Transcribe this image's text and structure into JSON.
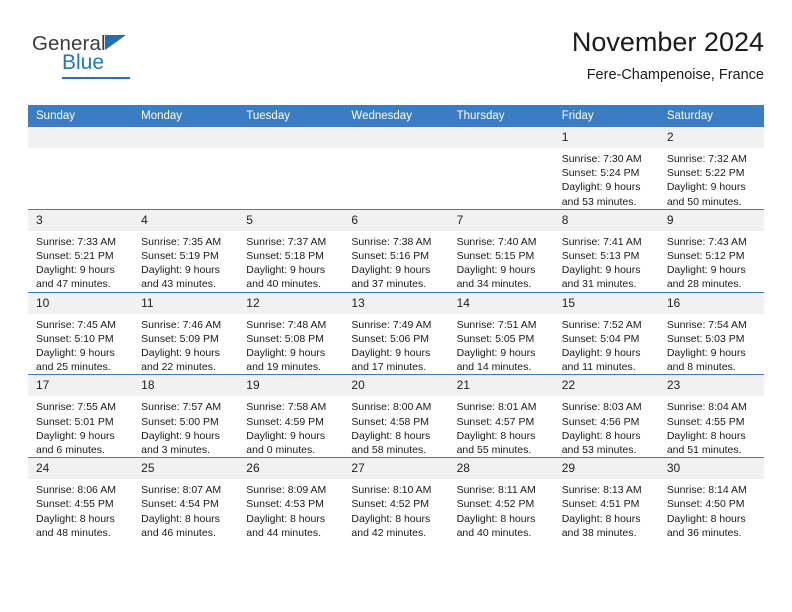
{
  "brand": {
    "name_part1": "General",
    "name_part2": "Blue",
    "accent_color": "#2077b9"
  },
  "header": {
    "title": "November 2024",
    "subtitle": "Fere-Champenoise, France"
  },
  "theme": {
    "header_row_color": "#3b7dc4",
    "daynum_bg": "#f1f1f1",
    "grid_line": "#3b7dc4"
  },
  "weekday_headers": [
    "Sunday",
    "Monday",
    "Tuesday",
    "Wednesday",
    "Thursday",
    "Friday",
    "Saturday"
  ],
  "labels": {
    "sunrise_prefix": "Sunrise:",
    "sunset_prefix": "Sunset:",
    "daylight_prefix": "Daylight:"
  },
  "weeks": [
    [
      {
        "day": "",
        "empty": true
      },
      {
        "day": "",
        "empty": true
      },
      {
        "day": "",
        "empty": true
      },
      {
        "day": "",
        "empty": true
      },
      {
        "day": "",
        "empty": true
      },
      {
        "day": "1",
        "sunrise": "Sunrise: 7:30 AM",
        "sunset": "Sunset: 5:24 PM",
        "daylight1": "Daylight: 9 hours",
        "daylight2": "and 53 minutes."
      },
      {
        "day": "2",
        "sunrise": "Sunrise: 7:32 AM",
        "sunset": "Sunset: 5:22 PM",
        "daylight1": "Daylight: 9 hours",
        "daylight2": "and 50 minutes."
      }
    ],
    [
      {
        "day": "3",
        "sunrise": "Sunrise: 7:33 AM",
        "sunset": "Sunset: 5:21 PM",
        "daylight1": "Daylight: 9 hours",
        "daylight2": "and 47 minutes."
      },
      {
        "day": "4",
        "sunrise": "Sunrise: 7:35 AM",
        "sunset": "Sunset: 5:19 PM",
        "daylight1": "Daylight: 9 hours",
        "daylight2": "and 43 minutes."
      },
      {
        "day": "5",
        "sunrise": "Sunrise: 7:37 AM",
        "sunset": "Sunset: 5:18 PM",
        "daylight1": "Daylight: 9 hours",
        "daylight2": "and 40 minutes."
      },
      {
        "day": "6",
        "sunrise": "Sunrise: 7:38 AM",
        "sunset": "Sunset: 5:16 PM",
        "daylight1": "Daylight: 9 hours",
        "daylight2": "and 37 minutes."
      },
      {
        "day": "7",
        "sunrise": "Sunrise: 7:40 AM",
        "sunset": "Sunset: 5:15 PM",
        "daylight1": "Daylight: 9 hours",
        "daylight2": "and 34 minutes."
      },
      {
        "day": "8",
        "sunrise": "Sunrise: 7:41 AM",
        "sunset": "Sunset: 5:13 PM",
        "daylight1": "Daylight: 9 hours",
        "daylight2": "and 31 minutes."
      },
      {
        "day": "9",
        "sunrise": "Sunrise: 7:43 AM",
        "sunset": "Sunset: 5:12 PM",
        "daylight1": "Daylight: 9 hours",
        "daylight2": "and 28 minutes."
      }
    ],
    [
      {
        "day": "10",
        "sunrise": "Sunrise: 7:45 AM",
        "sunset": "Sunset: 5:10 PM",
        "daylight1": "Daylight: 9 hours",
        "daylight2": "and 25 minutes."
      },
      {
        "day": "11",
        "sunrise": "Sunrise: 7:46 AM",
        "sunset": "Sunset: 5:09 PM",
        "daylight1": "Daylight: 9 hours",
        "daylight2": "and 22 minutes."
      },
      {
        "day": "12",
        "sunrise": "Sunrise: 7:48 AM",
        "sunset": "Sunset: 5:08 PM",
        "daylight1": "Daylight: 9 hours",
        "daylight2": "and 19 minutes."
      },
      {
        "day": "13",
        "sunrise": "Sunrise: 7:49 AM",
        "sunset": "Sunset: 5:06 PM",
        "daylight1": "Daylight: 9 hours",
        "daylight2": "and 17 minutes."
      },
      {
        "day": "14",
        "sunrise": "Sunrise: 7:51 AM",
        "sunset": "Sunset: 5:05 PM",
        "daylight1": "Daylight: 9 hours",
        "daylight2": "and 14 minutes."
      },
      {
        "day": "15",
        "sunrise": "Sunrise: 7:52 AM",
        "sunset": "Sunset: 5:04 PM",
        "daylight1": "Daylight: 9 hours",
        "daylight2": "and 11 minutes."
      },
      {
        "day": "16",
        "sunrise": "Sunrise: 7:54 AM",
        "sunset": "Sunset: 5:03 PM",
        "daylight1": "Daylight: 9 hours",
        "daylight2": "and 8 minutes."
      }
    ],
    [
      {
        "day": "17",
        "sunrise": "Sunrise: 7:55 AM",
        "sunset": "Sunset: 5:01 PM",
        "daylight1": "Daylight: 9 hours",
        "daylight2": "and 6 minutes."
      },
      {
        "day": "18",
        "sunrise": "Sunrise: 7:57 AM",
        "sunset": "Sunset: 5:00 PM",
        "daylight1": "Daylight: 9 hours",
        "daylight2": "and 3 minutes."
      },
      {
        "day": "19",
        "sunrise": "Sunrise: 7:58 AM",
        "sunset": "Sunset: 4:59 PM",
        "daylight1": "Daylight: 9 hours",
        "daylight2": "and 0 minutes."
      },
      {
        "day": "20",
        "sunrise": "Sunrise: 8:00 AM",
        "sunset": "Sunset: 4:58 PM",
        "daylight1": "Daylight: 8 hours",
        "daylight2": "and 58 minutes."
      },
      {
        "day": "21",
        "sunrise": "Sunrise: 8:01 AM",
        "sunset": "Sunset: 4:57 PM",
        "daylight1": "Daylight: 8 hours",
        "daylight2": "and 55 minutes."
      },
      {
        "day": "22",
        "sunrise": "Sunrise: 8:03 AM",
        "sunset": "Sunset: 4:56 PM",
        "daylight1": "Daylight: 8 hours",
        "daylight2": "and 53 minutes."
      },
      {
        "day": "23",
        "sunrise": "Sunrise: 8:04 AM",
        "sunset": "Sunset: 4:55 PM",
        "daylight1": "Daylight: 8 hours",
        "daylight2": "and 51 minutes."
      }
    ],
    [
      {
        "day": "24",
        "sunrise": "Sunrise: 8:06 AM",
        "sunset": "Sunset: 4:55 PM",
        "daylight1": "Daylight: 8 hours",
        "daylight2": "and 48 minutes."
      },
      {
        "day": "25",
        "sunrise": "Sunrise: 8:07 AM",
        "sunset": "Sunset: 4:54 PM",
        "daylight1": "Daylight: 8 hours",
        "daylight2": "and 46 minutes."
      },
      {
        "day": "26",
        "sunrise": "Sunrise: 8:09 AM",
        "sunset": "Sunset: 4:53 PM",
        "daylight1": "Daylight: 8 hours",
        "daylight2": "and 44 minutes."
      },
      {
        "day": "27",
        "sunrise": "Sunrise: 8:10 AM",
        "sunset": "Sunset: 4:52 PM",
        "daylight1": "Daylight: 8 hours",
        "daylight2": "and 42 minutes."
      },
      {
        "day": "28",
        "sunrise": "Sunrise: 8:11 AM",
        "sunset": "Sunset: 4:52 PM",
        "daylight1": "Daylight: 8 hours",
        "daylight2": "and 40 minutes."
      },
      {
        "day": "29",
        "sunrise": "Sunrise: 8:13 AM",
        "sunset": "Sunset: 4:51 PM",
        "daylight1": "Daylight: 8 hours",
        "daylight2": "and 38 minutes."
      },
      {
        "day": "30",
        "sunrise": "Sunrise: 8:14 AM",
        "sunset": "Sunset: 4:50 PM",
        "daylight1": "Daylight: 8 hours",
        "daylight2": "and 36 minutes."
      }
    ]
  ]
}
